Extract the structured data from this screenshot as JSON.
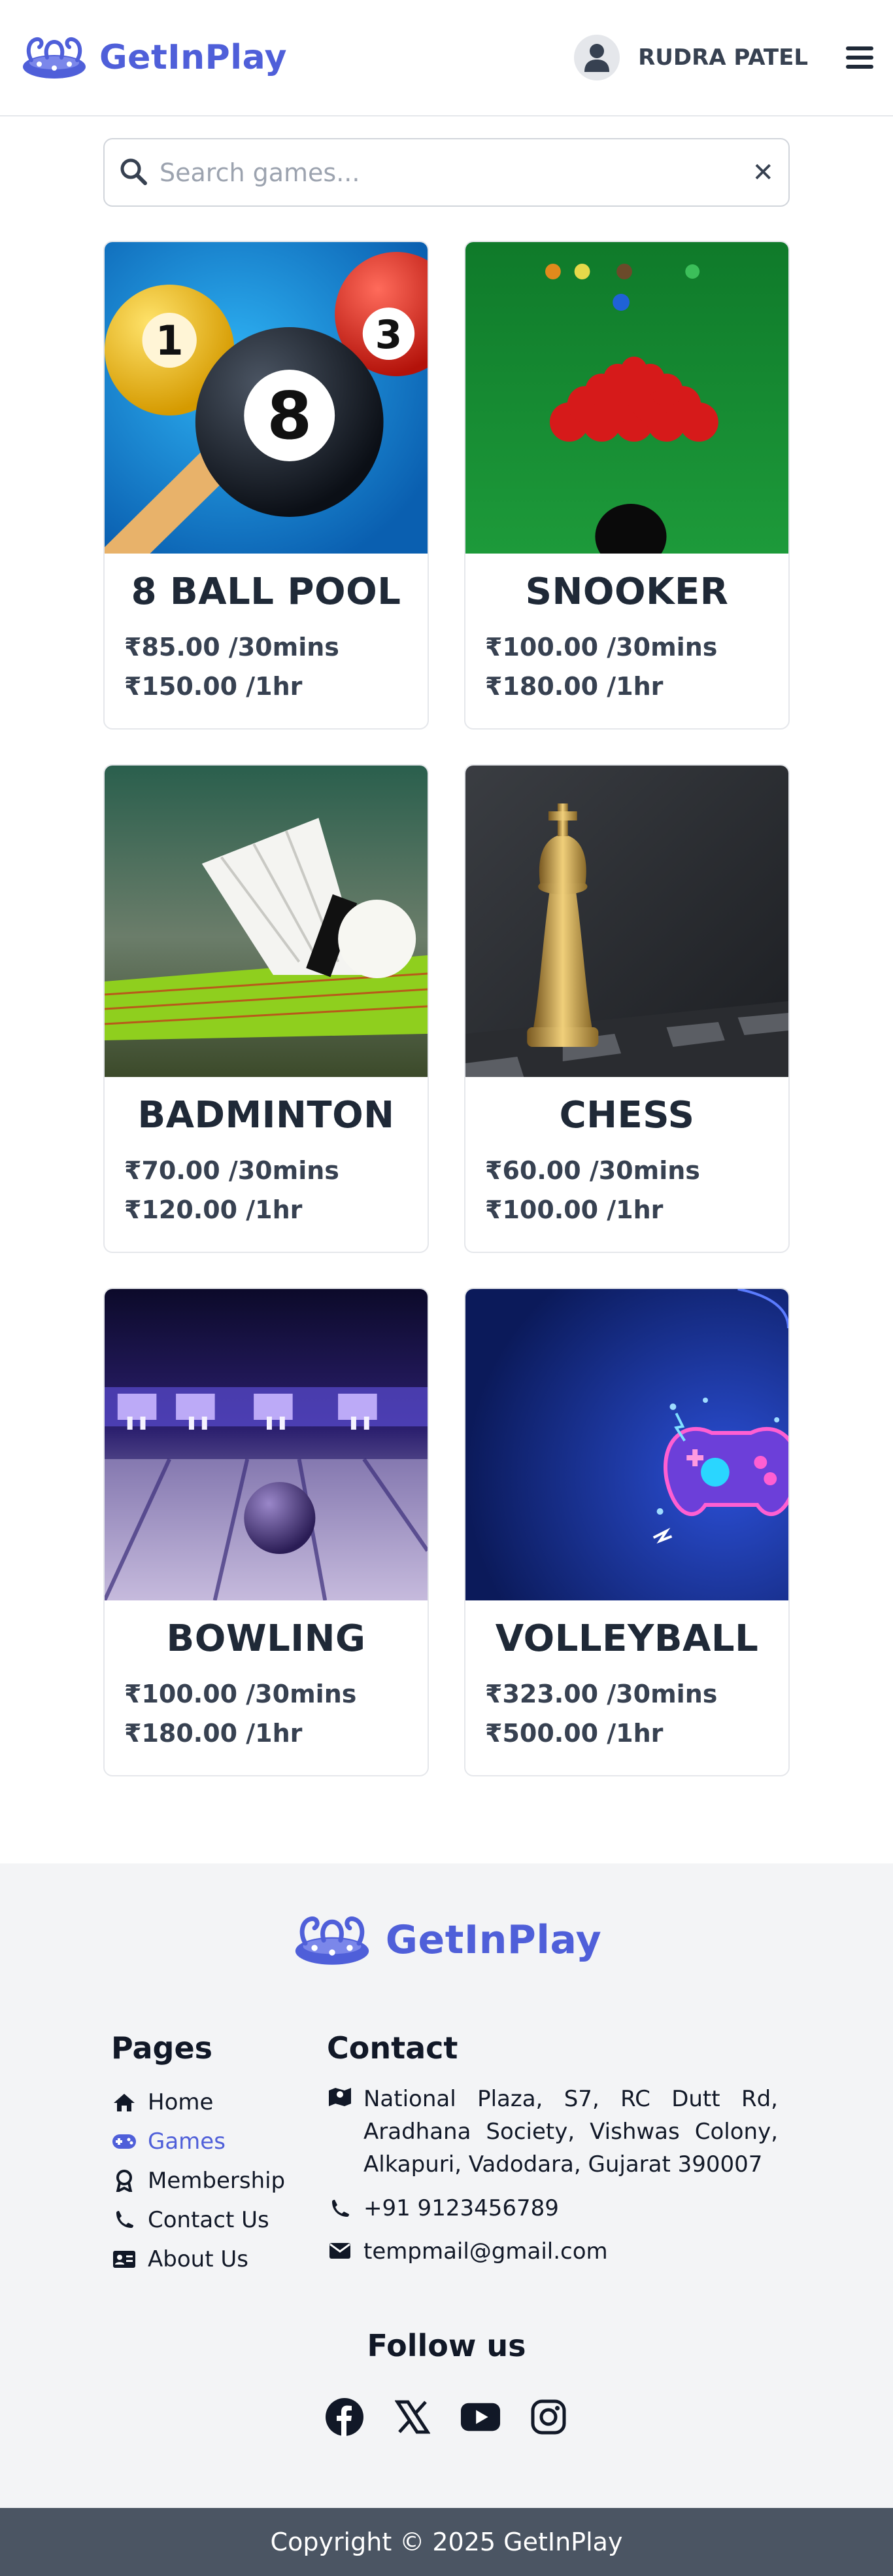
{
  "header": {
    "brand": "GetInPlay",
    "user_name": "RUDRA PATEL",
    "icons": {
      "logo": "playground-logo-icon",
      "avatar": "user-avatar-icon",
      "menu": "hamburger-menu-icon"
    }
  },
  "search": {
    "placeholder": "Search games...",
    "value": "",
    "icons": {
      "search": "search-icon",
      "clear": "close-icon"
    }
  },
  "games": [
    {
      "name": "8 BALL POOL",
      "price_30": "₹85.00 /30mins",
      "price_hr": "₹150.00 /1hr"
    },
    {
      "name": "SNOOKER",
      "price_30": "₹100.00 /30mins",
      "price_hr": "₹180.00 /1hr"
    },
    {
      "name": "BADMINTON",
      "price_30": "₹70.00 /30mins",
      "price_hr": "₹120.00 /1hr"
    },
    {
      "name": "CHESS",
      "price_30": "₹60.00 /30mins",
      "price_hr": "₹100.00 /1hr"
    },
    {
      "name": "BOWLING",
      "price_30": "₹100.00 /30mins",
      "price_hr": "₹180.00 /1hr"
    },
    {
      "name": "VOLLEYBALL",
      "price_30": "₹323.00 /30mins",
      "price_hr": "₹500.00 /1hr"
    }
  ],
  "footer": {
    "brand": "GetInPlay",
    "pages_title": "Pages",
    "pages": [
      {
        "label": "Home",
        "icon": "home-icon",
        "active": false
      },
      {
        "label": "Games",
        "icon": "gamepad-icon",
        "active": true
      },
      {
        "label": "Membership",
        "icon": "award-icon",
        "active": false
      },
      {
        "label": "Contact Us",
        "icon": "phone-icon",
        "active": false
      },
      {
        "label": "About Us",
        "icon": "id-card-icon",
        "active": false
      }
    ],
    "contact_title": "Contact",
    "address": "National Plaza, S7, RC Dutt Rd, Aradhana Society, Vishwas Colony, Alkapuri, Vadodara, Gujarat 390007",
    "phone": "+91 9123456789",
    "email": "tempmail@gmail.com",
    "follow_title": "Follow us",
    "socials": [
      "facebook-icon",
      "x-twitter-icon",
      "youtube-icon",
      "instagram-icon"
    ],
    "copyright": "Copyright © 2025 GetInPlay"
  },
  "colors": {
    "brand": "#4f5fd9",
    "text": "#1f2937",
    "footer_bg": "#f3f4f6",
    "copyright_bg": "#4b5563"
  }
}
